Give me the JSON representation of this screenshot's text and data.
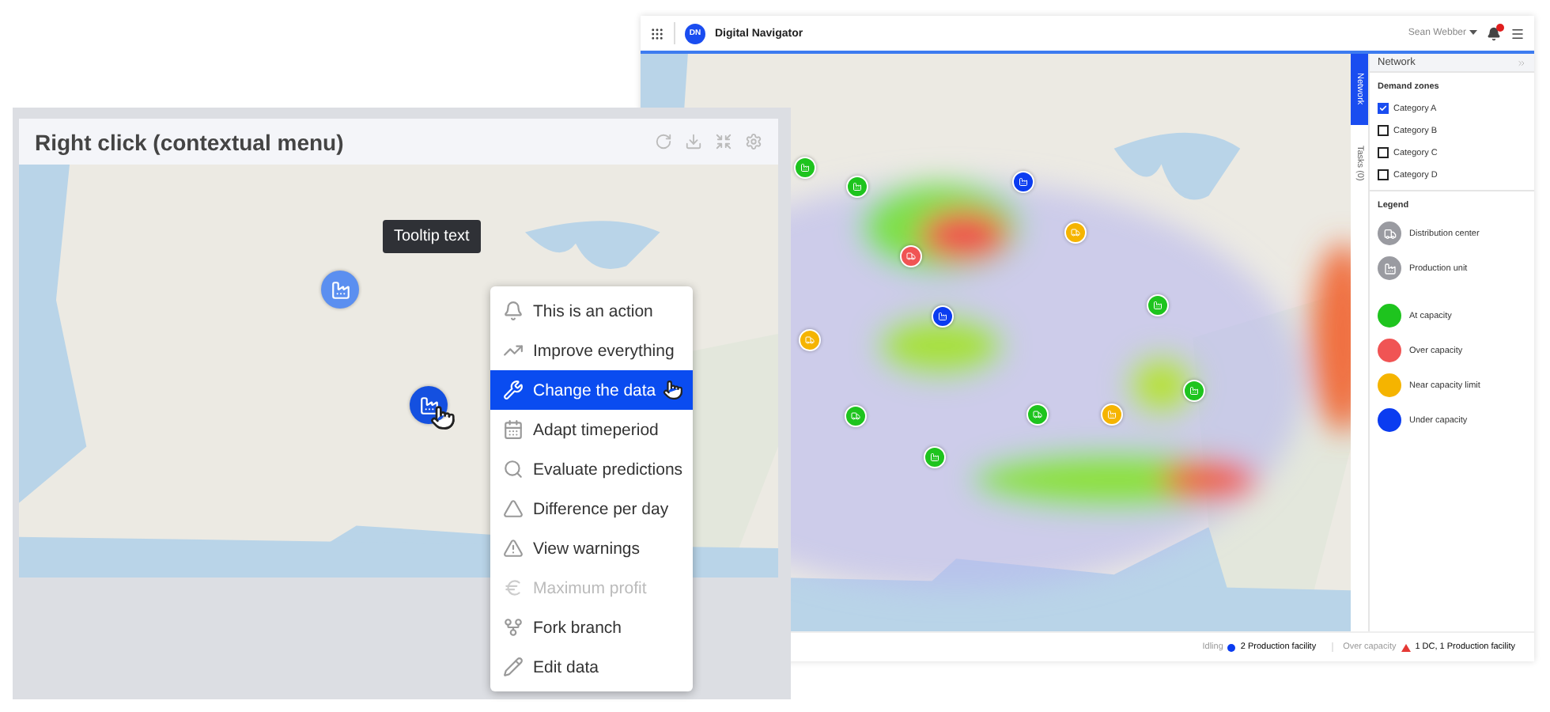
{
  "network_app": {
    "app_name": "Digital Navigator",
    "logo": "DN",
    "user": "Sean Webber",
    "markers": [
      {
        "kind": "factory",
        "color": "#1ec41e"
      },
      {
        "kind": "factory",
        "color": "#1ec41e"
      },
      {
        "kind": "factory",
        "color": "#0b3cf0"
      },
      {
        "kind": "truck",
        "color": "#f5b400"
      },
      {
        "kind": "truck",
        "color": "#f05454"
      },
      {
        "kind": "factory",
        "color": "#1ec41e"
      },
      {
        "kind": "factory",
        "color": "#0b3cf0"
      },
      {
        "kind": "truck",
        "color": "#f5b400"
      },
      {
        "kind": "truck",
        "color": "#1ec41e"
      },
      {
        "kind": "truck",
        "color": "#1ec41e"
      },
      {
        "kind": "factory",
        "color": "#f5b400"
      },
      {
        "kind": "factory",
        "color": "#1ec41e"
      },
      {
        "kind": "factory",
        "color": "#1ec41e"
      }
    ],
    "side_tabs": [
      {
        "label": "Network",
        "selected": true
      },
      {
        "label": "Tasks (0)",
        "selected": false
      }
    ],
    "panel": {
      "title": "Network",
      "demand_zones": {
        "heading": "Demand zones",
        "items": [
          {
            "label": "Category A",
            "checked": true
          },
          {
            "label": "Category B",
            "checked": false
          },
          {
            "label": "Category C",
            "checked": false
          },
          {
            "label": "Category D",
            "checked": false
          }
        ]
      },
      "legend": {
        "heading": "Legend",
        "items": [
          {
            "kind": "truck",
            "label": "Distribution center",
            "color": "#9a9ba1"
          },
          {
            "kind": "factory",
            "label": "Production unit",
            "color": "#9a9ba1"
          },
          {
            "kind": "dot",
            "label": "At capacity",
            "color": "#1ec41e"
          },
          {
            "kind": "dot",
            "label": "Over capacity",
            "color": "#f05454"
          },
          {
            "kind": "dot",
            "label": "Near capacity limit",
            "color": "#f5b400"
          },
          {
            "kind": "dot",
            "label": "Under capacity",
            "color": "#0b3cf0"
          }
        ]
      }
    },
    "status_bar": [
      {
        "label": "Idling",
        "kind": "dot",
        "color": "#0b3cf0",
        "text": "2 Production facility"
      },
      {
        "label": "Over capacity",
        "kind": "warning",
        "color": "#e53935",
        "text": "1 DC, 1 Production facility"
      }
    ]
  },
  "context_menu_demo": {
    "title": "Right click (contextual menu)",
    "tooltip": "Tooltip text",
    "markers": [
      {
        "kind": "factory",
        "color": "#5b8ff0"
      },
      {
        "kind": "factory",
        "color": "#1450e0"
      }
    ],
    "context_menu": [
      {
        "kind": "bell",
        "label": "This is an action",
        "selected": false,
        "disabled": false
      },
      {
        "kind": "trend",
        "label": "Improve everything",
        "selected": false,
        "disabled": false
      },
      {
        "kind": "wrench",
        "label": "Change the data",
        "selected": true,
        "disabled": false
      },
      {
        "kind": "calendar",
        "label": "Adapt timeperiod",
        "selected": false,
        "disabled": false
      },
      {
        "kind": "search",
        "label": "Evaluate predictions",
        "selected": false,
        "disabled": false
      },
      {
        "kind": "triangle",
        "label": "Difference per day",
        "selected": false,
        "disabled": false
      },
      {
        "kind": "warning",
        "label": "View warnings",
        "selected": false,
        "disabled": false
      },
      {
        "kind": "euro",
        "label": "Maximum profit",
        "selected": false,
        "disabled": true
      },
      {
        "kind": "fork",
        "label": "Fork branch",
        "selected": false,
        "disabled": false
      },
      {
        "kind": "pencil",
        "label": "Edit data",
        "selected": false,
        "disabled": false
      }
    ]
  }
}
